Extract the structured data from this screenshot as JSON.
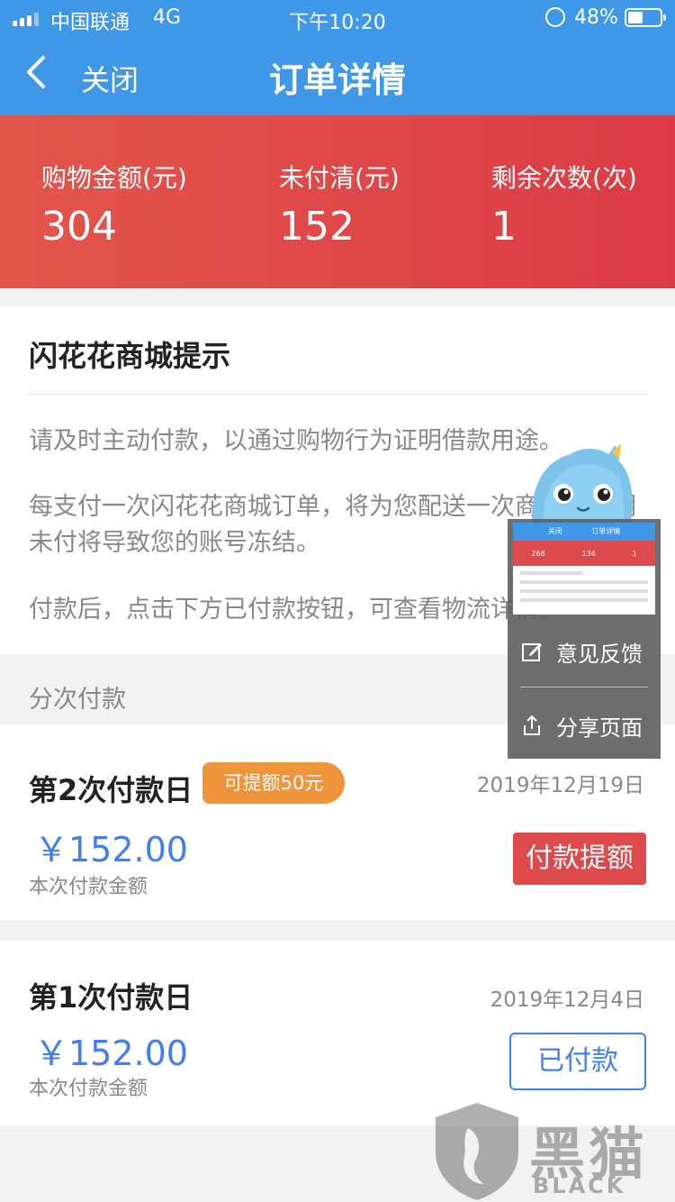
{
  "status_bar": {
    "carrier": "中国联通",
    "network": "4G",
    "time": "下午10:20",
    "battery_percent": "48%",
    "battery_level": 0.48
  },
  "nav": {
    "back_icon": "chevron-left-icon",
    "close_label": "关闭",
    "title": "订单详情"
  },
  "summary": {
    "items": [
      {
        "label": "购物金额(元)",
        "value": "304"
      },
      {
        "label": "未付清(元)",
        "value": "152"
      },
      {
        "label": "剩余次数(次)",
        "value": "1"
      }
    ]
  },
  "notice": {
    "title": "闪花花商城提示",
    "lines": [
      "请及时主动付款，以通过购物行为证明借款用途。",
      "每支付一次闪花花商城订单，将为您配送一次商品。超期未付将导致您的账号冻结。",
      "付款后，点击下方已付款按钮，可查看物流详情。"
    ]
  },
  "installments": {
    "section_label": "分次付款",
    "items": [
      {
        "title": "第2次付款日",
        "badge": "可提额50元",
        "date": "2019年12月19日",
        "amount": "￥152.00",
        "sub": "本次付款金额",
        "button": "付款提额"
      },
      {
        "title": "第1次付款日",
        "date": "2019年12月4日",
        "amount": "￥152.00",
        "sub": "本次付款金额",
        "button": "已付款"
      }
    ]
  },
  "float_menu": {
    "thumb": {
      "title": "订单详情",
      "back": "关闭",
      "values": [
        "268",
        "134",
        "1"
      ]
    },
    "items": [
      {
        "label": "意见反馈",
        "icon": "edit-icon"
      },
      {
        "label": "分享页面",
        "icon": "share-icon"
      }
    ]
  },
  "watermark": {
    "cn": "黑猫",
    "en": "BLACK CAT"
  },
  "colors": {
    "nav_blue": "#3f97e8",
    "summary_red": "#dc3b46",
    "amount_blue": "#3f7ff0",
    "badge_orange": "#f0943b",
    "pay_button_red": "#de4a4c"
  }
}
